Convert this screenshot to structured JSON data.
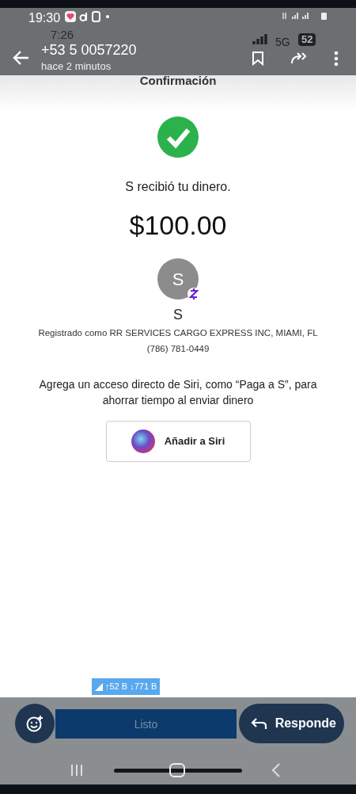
{
  "status_bar": {
    "time": "19:30"
  },
  "underlying_status_bar": {
    "time": "7:26",
    "network": "5G",
    "battery": "52"
  },
  "header": {
    "title": "+53 5 0057220",
    "subtitle": "hace 2 minutos"
  },
  "screen": {
    "title": "Confirmación",
    "message": "S recibió tu dinero.",
    "amount": "$100.00",
    "avatar_initial": "S",
    "name": "S",
    "registered": "Registrado como RR SERVICES CARGO EXPRESS INC, MIAMI, FL",
    "phone": "(786) 781-0449",
    "siri_prompt": "Agrega un acceso directo de Siri, como “Paga a S”, para ahorrar tiempo al enviar dinero",
    "siri_button": "Añadir a Siri"
  },
  "network_badge": {
    "speed": "↑52 B ↓771 B"
  },
  "reply_bar": {
    "placeholder": "Listo",
    "reply_button": "Responde"
  }
}
